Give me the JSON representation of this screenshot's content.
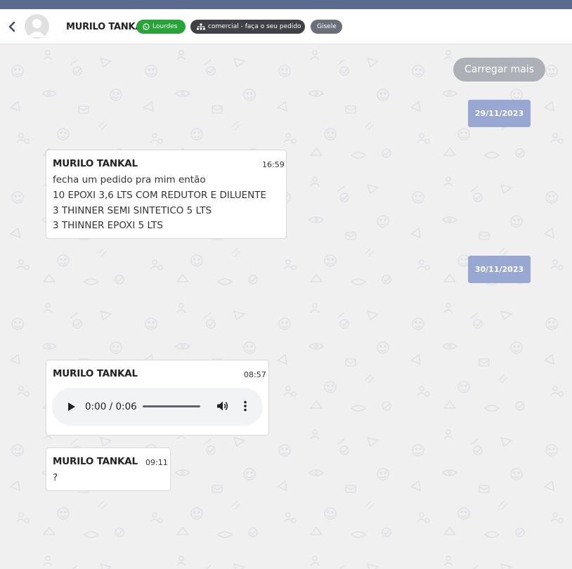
{
  "header": {
    "contact_name": "MURILO TANKAL",
    "tags": [
      {
        "label": "Lourdes",
        "color": "#27a338",
        "icon": "whatsapp-icon"
      },
      {
        "label": "comercial - faça o seu pedido",
        "color": "#3f4147",
        "icon": "sitemap-icon"
      },
      {
        "label": "Gisele",
        "color": "#6a7079"
      }
    ]
  },
  "chat": {
    "load_more": "Carregar mais",
    "dates": [
      "29/11/2023",
      "30/11/2023"
    ],
    "messages": [
      {
        "sender": "MURILO TANKAL",
        "time": "16:59",
        "lines": [
          "fecha um pedido pra mim então",
          "10 EPOXI 3,6 LTS COM REDUTOR E DILUENTE",
          "3 THINNER SEMI SINTETICO 5 LTS",
          "3 THINNER EPOXI 5 LTS"
        ]
      },
      {
        "sender": "MURILO TANKAL",
        "time": "08:57",
        "audio_time": "0:00 / 0:06"
      },
      {
        "sender": "MURILO TANKAL",
        "time": "09:11",
        "lines": [
          "?"
        ]
      }
    ]
  },
  "colors": {
    "top_strip": "#5a6b8f",
    "date_chip": "#98a8d2",
    "chat_bg": "#f0f0f1"
  }
}
